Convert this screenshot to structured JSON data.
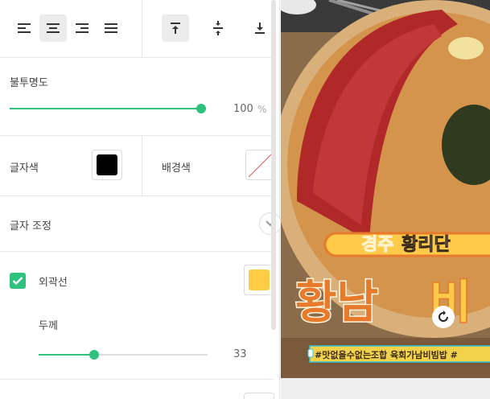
{
  "alignment": {
    "horizontal": [
      "align-left-icon",
      "align-center-icon",
      "align-right-icon",
      "align-justify-icon"
    ],
    "vertical": [
      "align-top-icon",
      "align-middle-icon",
      "align-bottom-icon"
    ],
    "active_horizontal": "center",
    "active_vertical": "top"
  },
  "opacity": {
    "label": "불투명도",
    "value": "100",
    "unit": "%",
    "level": 100
  },
  "text_color": {
    "label": "글자색",
    "color": "#000000"
  },
  "background_color": {
    "label": "배경색",
    "color": "none"
  },
  "text_adjust": {
    "label": "글자 조정"
  },
  "outline": {
    "label": "외곽선",
    "checked": true,
    "color": "#ffcc44",
    "thickness_label": "두께",
    "thickness_value": "33",
    "thickness_level": 0.33
  },
  "canvas": {
    "subtitle_parts": [
      "경주",
      "황리단"
    ],
    "headline_parts": [
      "황남",
      "비"
    ],
    "hashtag_line": "#맛없을수없는조합 육회가남비빔밥 #"
  },
  "colors": {
    "accent": "#2ec27e",
    "headline_orange": "#e87a2c",
    "banner_yellow": "#ffc94a",
    "selection": "#35c4d6"
  }
}
